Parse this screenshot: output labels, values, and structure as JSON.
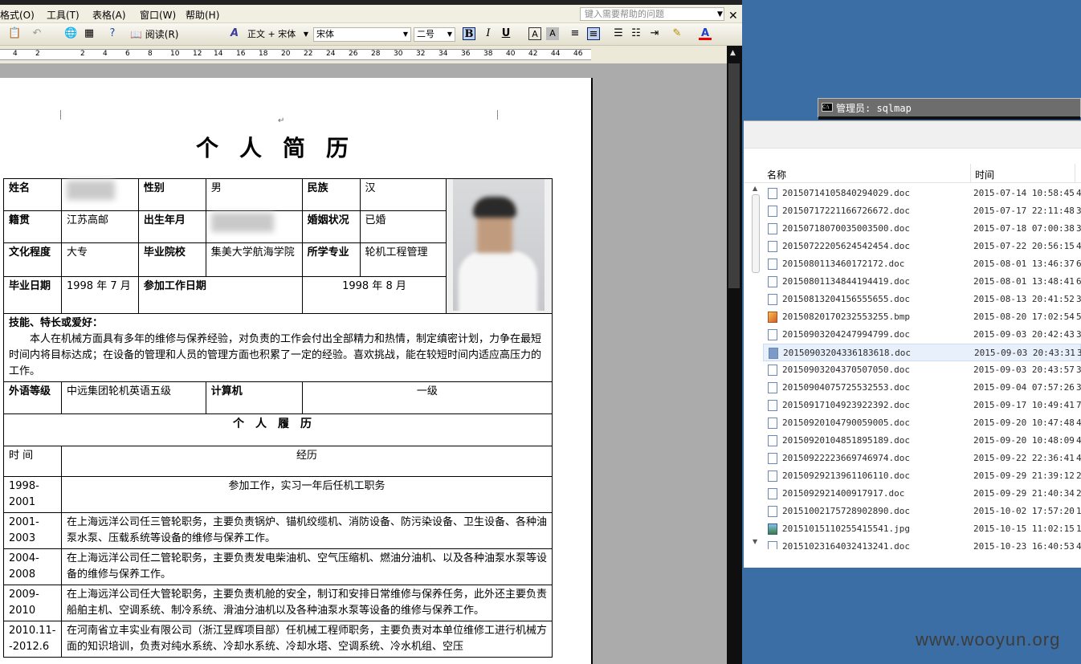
{
  "word": {
    "menu": [
      "格式(O)",
      "工具(T)",
      "表格(A)",
      "窗口(W)",
      "帮助(H)"
    ],
    "help_placeholder": "键入需要帮助的问题",
    "toolbar": {
      "reading_label": "阅读(R)",
      "style_value": "正文 + 宋体",
      "font_value": "宋体",
      "size_value": "二号",
      "bold": "B",
      "italic": "I",
      "underline": "U"
    },
    "ruler_ticks": [
      "4",
      "2",
      "2",
      "4",
      "6",
      "8",
      "10",
      "12",
      "14",
      "16",
      "18",
      "20",
      "22",
      "24",
      "26",
      "28",
      "30",
      "32",
      "34",
      "36",
      "38",
      "40",
      "42",
      "44",
      "46"
    ]
  },
  "resume": {
    "title": "个人简历",
    "labels": {
      "name": "姓名",
      "gender": "性别",
      "ethnicity": "民族",
      "hometown": "籍贯",
      "birth": "出生年月",
      "marital": "婚姻状况",
      "education": "文化程度",
      "school": "毕业院校",
      "major": "所学专业",
      "grad_date": "毕业日期",
      "work_start": "参加工作日期",
      "skills": "技能、特长或爱好：",
      "language": "外语等级",
      "computer": "计算机",
      "history_title": "个人履历",
      "time_col": "时 间",
      "exp_col": "经历"
    },
    "values": {
      "gender": "男",
      "ethnicity": "汉",
      "hometown": "江苏高邮",
      "marital": "已婚",
      "education": "大专",
      "school": "集美大学航海学院",
      "major": "轮机工程管理",
      "grad_date": "1998 年 7 月",
      "work_start": "1998 年 8 月",
      "skills": "本人在机械方面具有多年的维修与保养经验，对负责的工作会付出全部精力和热情，制定缜密计划，力争在最短时间内将目标达成；在设备的管理和人员的管理方面也积累了一定的经验。喜欢挑战，能在较短时间内适应高压力的工作。",
      "language": "中远集团轮机英语五级",
      "computer": "一级"
    },
    "history": [
      {
        "time": "1998-2001",
        "desc": "参加工作，实习一年后任机工职务"
      },
      {
        "time": "2001-2003",
        "desc": "在上海远洋公司任三管轮职务，主要负责锅炉、锚机绞缆机、消防设备、防污染设备、卫生设备、各种油泵水泵、压载系统等设备的维修与保养工作。"
      },
      {
        "time": "2004-2008",
        "desc": "在上海远洋公司任二管轮职务，主要负责发电柴油机、空气压缩机、燃油分油机、以及各种油泵水泵等设备的维修与保养工作。"
      },
      {
        "time": "2009-2010",
        "desc": "在上海远洋公司任大管轮职务，主要负责机舱的安全，制订和安排日常维修与保养任务，此外还主要负责船舶主机、空调系统、制冷系统、滑油分油机以及各种油泵水泵等设备的维修与保养工作。"
      },
      {
        "time": "2010.11--2012.6",
        "desc": "在河南省立丰实业有限公司（浙江昱辉项目部）任机械工程师职务，主要负责对本单位维修工进行机械方面的知识培训，负责对纯水系统、冷却水系统、冷却水塔、空调系统、冷水机组、空压"
      }
    ]
  },
  "cmd": {
    "title": "管理员: sqlmap"
  },
  "explorer": {
    "columns": [
      "名称",
      "时间"
    ],
    "files": [
      {
        "name": "20150714105840294029.doc",
        "time": "2015-07-14 10:58:45",
        "extra": "4",
        "type": "doc"
      },
      {
        "name": "20150717221166726672.doc",
        "time": "2015-07-17 22:11:48",
        "extra": "3",
        "type": "doc"
      },
      {
        "name": "20150718070035003500.doc",
        "time": "2015-07-18 07:00:38",
        "extra": "3",
        "type": "doc"
      },
      {
        "name": "20150722205624542454.doc",
        "time": "2015-07-22 20:56:15",
        "extra": "4",
        "type": "doc"
      },
      {
        "name": "2015080113460172172.doc",
        "time": "2015-08-01 13:46:37",
        "extra": "6",
        "type": "doc"
      },
      {
        "name": "20150801134844194419.doc",
        "time": "2015-08-01 13:48:41",
        "extra": "6",
        "type": "doc"
      },
      {
        "name": "20150813204156555655.doc",
        "time": "2015-08-13 20:41:52",
        "extra": "3",
        "type": "doc"
      },
      {
        "name": "20150820170232553255.bmp",
        "time": "2015-08-20 17:02:54",
        "extra": "5",
        "type": "bmp"
      },
      {
        "name": "20150903204247994799.doc",
        "time": "2015-09-03 20:42:43",
        "extra": "3",
        "type": "doc"
      },
      {
        "name": "20150903204336183618.doc",
        "time": "2015-09-03 20:43:31",
        "extra": "3",
        "type": "doc",
        "selected": true
      },
      {
        "name": "20150903204370507050.doc",
        "time": "2015-09-03 20:43:57",
        "extra": "3",
        "type": "doc"
      },
      {
        "name": "20150904075725532553.doc",
        "time": "2015-09-04 07:57:26",
        "extra": "3",
        "type": "doc"
      },
      {
        "name": "20150917104923922392.doc",
        "time": "2015-09-17 10:49:41",
        "extra": "7",
        "type": "doc"
      },
      {
        "name": "20150920104790059005.doc",
        "time": "2015-09-20 10:47:48",
        "extra": "4",
        "type": "doc"
      },
      {
        "name": "20150920104851895189.doc",
        "time": "2015-09-20 10:48:09",
        "extra": "4",
        "type": "doc"
      },
      {
        "name": "20150922223669746974.doc",
        "time": "2015-09-22 22:36:41",
        "extra": "4",
        "type": "doc"
      },
      {
        "name": "20150929213961106110.doc",
        "time": "2015-09-29 21:39:12",
        "extra": "2",
        "type": "doc"
      },
      {
        "name": "2015092921400917917.doc",
        "time": "2015-09-29 21:40:34",
        "extra": "2",
        "type": "doc"
      },
      {
        "name": "20151002175728902890.doc",
        "time": "2015-10-02 17:57:20",
        "extra": "1",
        "type": "doc"
      },
      {
        "name": "20151015110255415541.jpg",
        "time": "2015-10-15 11:02:15",
        "extra": "1",
        "type": "jpg"
      },
      {
        "name": "20151023164032413241.doc",
        "time": "2015-10-23 16:40:53",
        "extra": "4",
        "type": "doc"
      }
    ]
  },
  "watermark": "www.wooyun.org"
}
